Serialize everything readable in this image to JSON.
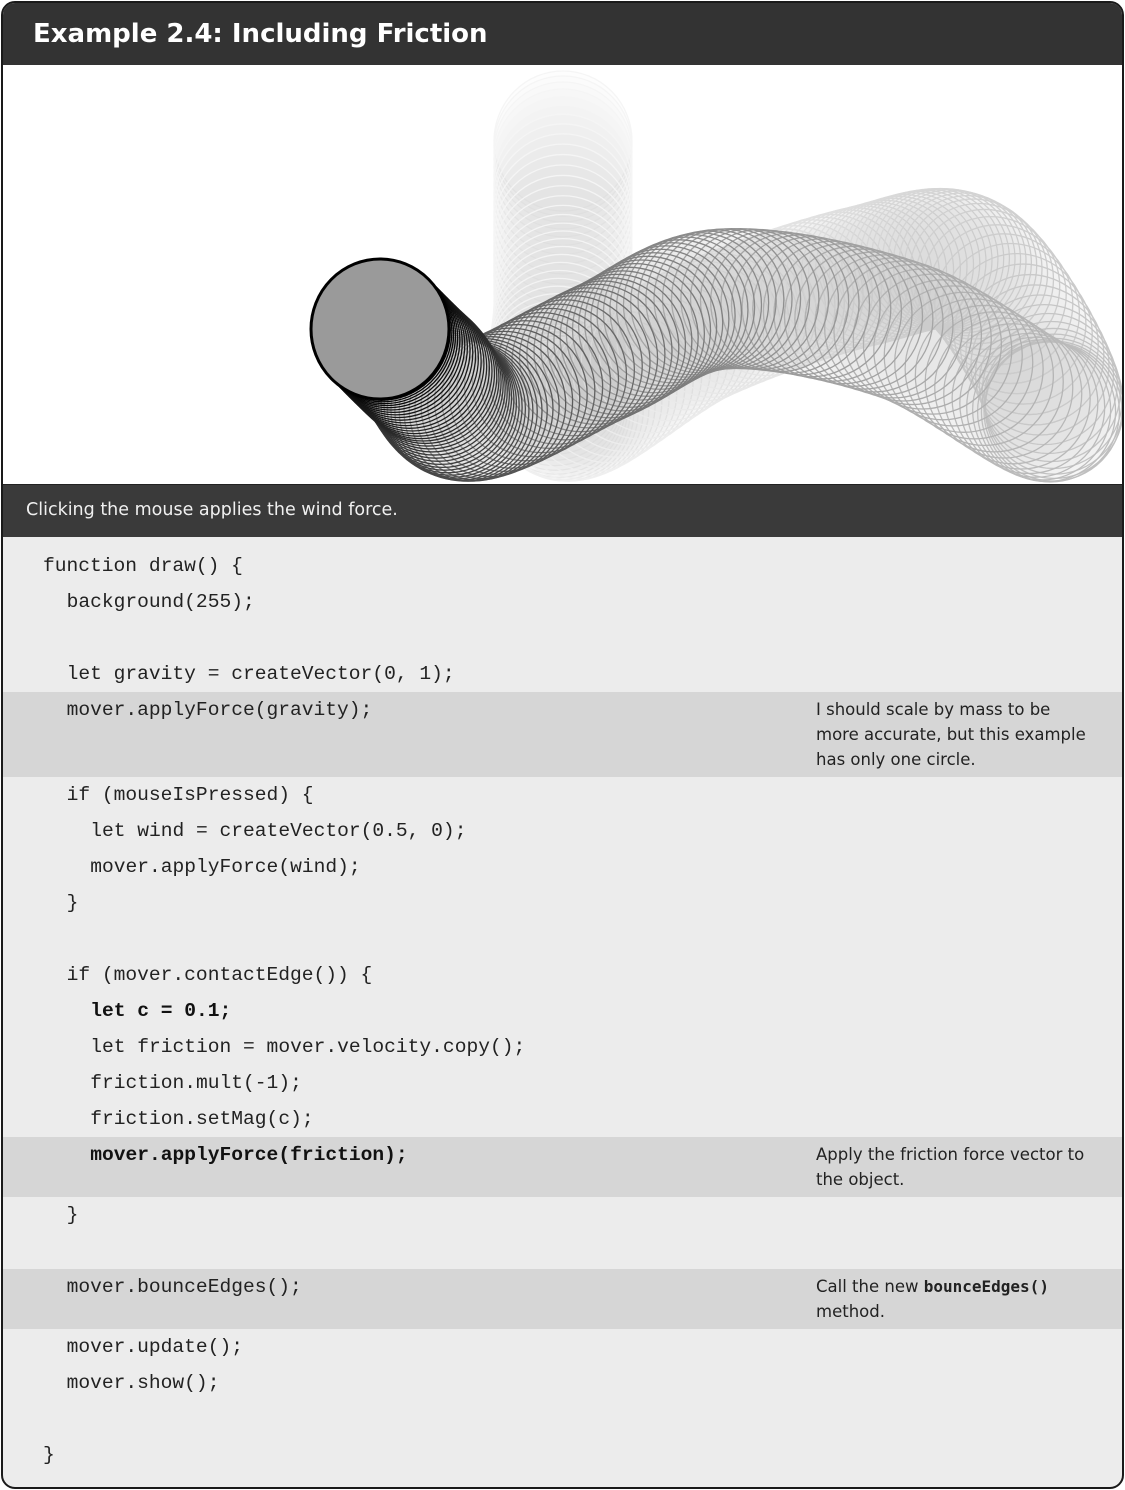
{
  "title": "Example 2.4: Including Friction",
  "caption": "Clicking the mouse applies the wind force.",
  "colors": {
    "header_bg": "#333333",
    "caption_bg": "#3a3a3a",
    "code_bg": "#ececec",
    "highlight_bg": "#d6d6d6"
  },
  "code": [
    {
      "text": "function draw() {",
      "indent": 0
    },
    {
      "text": "background(255);",
      "indent": 1
    },
    {
      "text": "",
      "indent": 0
    },
    {
      "text": "let gravity = createVector(0, 1);",
      "indent": 1
    },
    {
      "text": "mover.applyForce(gravity);",
      "indent": 1,
      "note": [
        {
          "text": "I should scale by mass to be more accurate, but this example has only one circle."
        }
      ]
    },
    {
      "text": "if (mouseIsPressed) {",
      "indent": 1
    },
    {
      "text": "let wind = createVector(0.5, 0);",
      "indent": 2
    },
    {
      "text": "mover.applyForce(wind);",
      "indent": 2
    },
    {
      "text": "}",
      "indent": 1
    },
    {
      "text": "",
      "indent": 0
    },
    {
      "text": "if (mover.contactEdge()) {",
      "indent": 1
    },
    {
      "text": "let c = 0.1;",
      "indent": 2,
      "bold": true
    },
    {
      "text": "let friction = mover.velocity.copy();",
      "indent": 2
    },
    {
      "text": "friction.mult(-1);",
      "indent": 2
    },
    {
      "text": "friction.setMag(c);",
      "indent": 2
    },
    {
      "text": "mover.applyForce(friction);",
      "indent": 2,
      "bold": true,
      "note": [
        {
          "text": "Apply the friction force vector to the object."
        }
      ]
    },
    {
      "text": "}",
      "indent": 1
    },
    {
      "text": "",
      "indent": 0
    },
    {
      "text": "mover.bounceEdges();",
      "indent": 1,
      "note": [
        {
          "text": "Call the new "
        },
        {
          "text": "bounceEdges()",
          "code": true
        },
        {
          "text": " method."
        }
      ]
    },
    {
      "text": "mover.update();",
      "indent": 1
    },
    {
      "text": "mover.show();",
      "indent": 1
    },
    {
      "text": "",
      "indent": 0
    },
    {
      "text": "}",
      "indent": 0
    }
  ]
}
